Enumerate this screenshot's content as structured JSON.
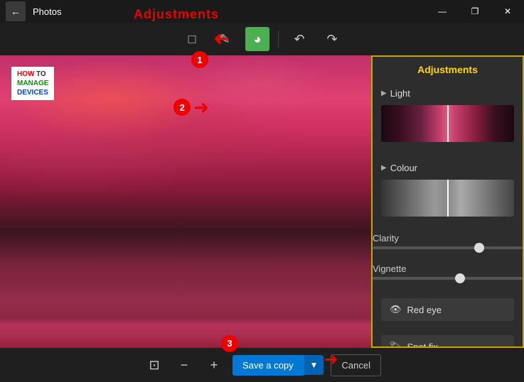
{
  "titleBar": {
    "title": "Photos",
    "controls": {
      "minimize": "—",
      "maximize": "❐",
      "close": "✕"
    }
  },
  "toolbar": {
    "cropIcon": "⊡",
    "penIcon": "✎",
    "adjustIcon": "◑",
    "undoIcon": "↶",
    "redoIcon": "↷"
  },
  "annotations": {
    "title": "Adjustments",
    "label1": "1",
    "label2": "2",
    "label3": "3"
  },
  "panel": {
    "title": "Adjustments",
    "sections": {
      "light": "Light",
      "colour": "Colour",
      "clarity": "Clarity",
      "vignette": "Vignette"
    },
    "sliders": {
      "clarityValue": 68,
      "vignetteValue": 55
    },
    "buttons": {
      "redEye": "Red eye",
      "spotFix": "Spot fix"
    }
  },
  "bottomBar": {
    "cropIcon": "⊡",
    "zoomOut": "−",
    "zoomIn": "+",
    "saveCopy": "Save a copy",
    "cancel": "Cancel"
  },
  "watermark": {
    "how": "HOW",
    "to": "TO",
    "manage": "MANAGE",
    "devices": "DEVICES"
  }
}
